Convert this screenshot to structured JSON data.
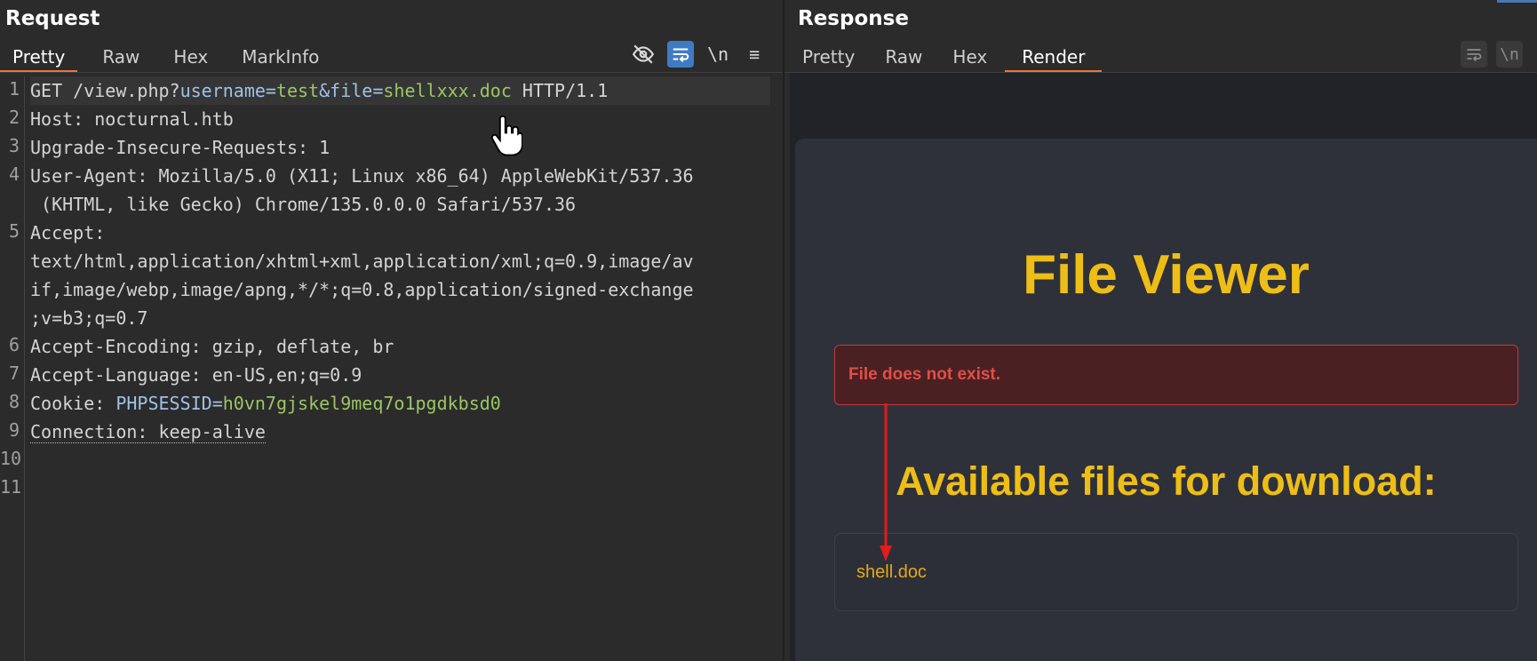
{
  "request": {
    "title": "Request",
    "tabs": [
      "Pretty",
      "Raw",
      "Hex",
      "MarkInfo"
    ],
    "toolbar_icons": [
      "eye-off-icon",
      "wrap-icon",
      "newline-icon",
      "menu-icon"
    ],
    "newline_label": "\\n",
    "menu_label": "≡",
    "line_numbers": [
      "1",
      "2",
      "3",
      "4",
      "5",
      "6",
      "7",
      "8",
      "9",
      "10",
      "11"
    ],
    "lines": {
      "l1_method": "GET /view.php?",
      "l1_p1": "username",
      "l1_eq1": "=",
      "l1_v1": "test",
      "l1_amp": "&",
      "l1_p2": "file",
      "l1_eq2": "=",
      "l1_v2": "shellxxx.doc",
      "l1_proto": " HTTP/1.1",
      "l2": "Host: nocturnal.htb",
      "l3": "Upgrade-Insecure-Requests: 1",
      "l4a": "User-Agent: Mozilla/5.0 (X11; Linux x86_64) AppleWebKit/537.36",
      "l4b": " (KHTML, like Gecko) Chrome/135.0.0.0 Safari/537.36",
      "l5a": "Accept:",
      "l5b": "text/html,application/xhtml+xml,application/xml;q=0.9,image/av",
      "l5c": "if,image/webp,image/apng,*/*;q=0.8,application/signed-exchange",
      "l5d": ";v=b3;q=0.7",
      "l6": "Accept-Encoding: gzip, deflate, br",
      "l7": "Accept-Language: en-US,en;q=0.9",
      "l8_key": "Cookie: ",
      "l8_name": "PHPSESSID",
      "l8_eq": "=",
      "l8_val": "h0vn7gjskel9meq7o1pgdkbsd0",
      "l9": "Connection: keep-alive"
    }
  },
  "response": {
    "title": "Response",
    "tabs": [
      "Pretty",
      "Raw",
      "Hex",
      "Render"
    ],
    "toolbar_icons": [
      "wrap-icon",
      "newline-icon"
    ],
    "newline_label": "\\n",
    "render": {
      "heading": "File Viewer",
      "error": "File does not exist.",
      "files_heading": "Available files for download:",
      "files": [
        "shell.doc"
      ]
    }
  },
  "colors": {
    "accent_tab": "#e8773a",
    "heading_yellow": "#eebe16",
    "error_red": "#e24e46",
    "file_link": "#e6a817",
    "arrow_red": "#e31b1b"
  }
}
